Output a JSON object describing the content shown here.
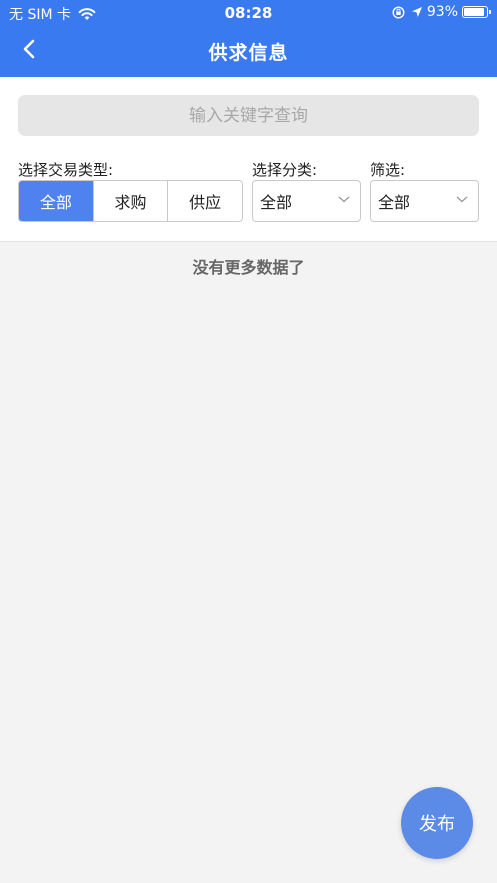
{
  "status_bar": {
    "carrier": "无 SIM 卡",
    "time": "08:28",
    "battery": "93%",
    "battery_level": 0.93
  },
  "header": {
    "title": "供求信息"
  },
  "search": {
    "placeholder": "输入关键字查询"
  },
  "filters": {
    "trade_type_label": "选择交易类型:",
    "trade_type_options": [
      "全部",
      "求购",
      "供应"
    ],
    "trade_type_selected": "全部",
    "category_label": "选择分类:",
    "category_value": "全部",
    "filter_label": "筛选:",
    "filter_value": "全部"
  },
  "list": {
    "empty_text": "没有更多数据了"
  },
  "fab": {
    "label": "发布"
  },
  "colors": {
    "primary": "#3a7af0",
    "segment_active": "#4f82ee",
    "fab": "#5b8be6",
    "background": "#f3f3f3"
  },
  "icons": [
    "wifi-icon",
    "rotation-lock-icon",
    "location-arrow-icon",
    "battery-icon",
    "back-arrow-icon",
    "chevron-down-icon"
  ]
}
